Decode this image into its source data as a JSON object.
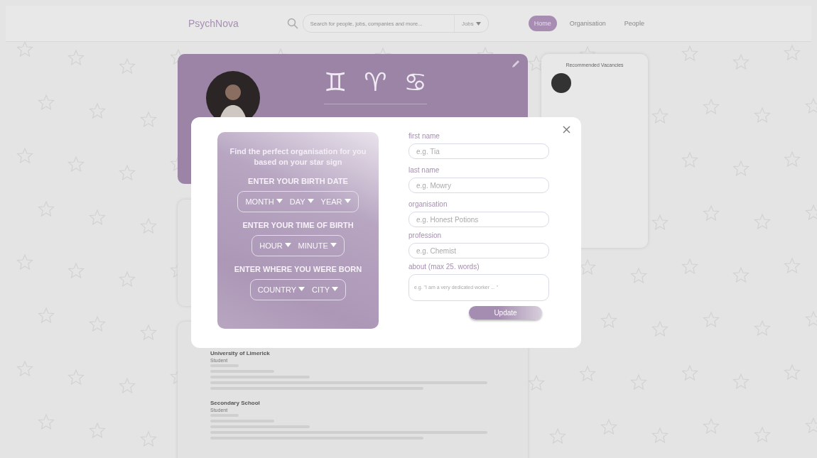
{
  "header": {
    "logo": "PsychNova",
    "search": {
      "placeholder": "Search for people, jobs, companies and more..."
    },
    "filter": "Jobs",
    "nav": [
      {
        "label": "Home",
        "selected": true
      },
      {
        "label": "Organisation",
        "selected": false
      },
      {
        "label": "People",
        "selected": false
      }
    ]
  },
  "profile": {
    "signs": [
      "♊",
      "♈",
      "♋"
    ]
  },
  "vacancies": {
    "title": "Recommended Vacancies"
  },
  "education": [
    {
      "school": "University of Limerick",
      "role": "Student"
    },
    {
      "school": "Secondary School",
      "role": "Student"
    }
  ],
  "modal": {
    "intro": "Find the perfect organisation for you based on your star sign",
    "sections": [
      {
        "heading": "ENTER YOUR BIRTH DATE",
        "selects": [
          "MONTH",
          "DAY",
          "YEAR"
        ]
      },
      {
        "heading": "ENTER YOUR TIME OF BIRTH",
        "selects": [
          "HOUR",
          "MINUTE"
        ]
      },
      {
        "heading": "ENTER WHERE YOU WERE BORN",
        "selects": [
          "COUNTRY",
          "CITY"
        ]
      }
    ],
    "fields": [
      {
        "label": "first name",
        "placeholder": "e.g. Tia",
        "kind": "line"
      },
      {
        "label": "last name",
        "placeholder": "e.g. Mowry",
        "kind": "line"
      },
      {
        "label": "organisation",
        "placeholder": "e.g. Honest Potions",
        "kind": "line"
      },
      {
        "label": "profession",
        "placeholder": "e.g. Chemist",
        "kind": "line"
      },
      {
        "label": "about (max 25. words)",
        "placeholder": "e.g. \"I am a very dedicated worker ... \"",
        "kind": "area"
      }
    ],
    "button": "Update"
  }
}
